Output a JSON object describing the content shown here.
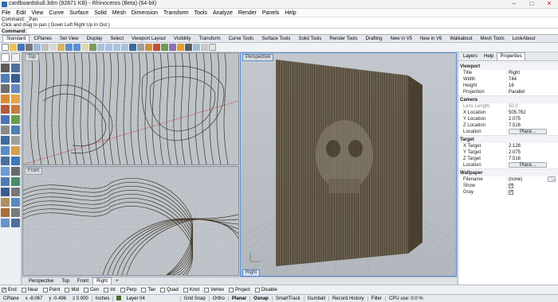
{
  "window": {
    "title": "cardboardskull.3dm (92871 KB) - Rhinoceros (Beta) (64-bit)",
    "min": "–",
    "max": "□",
    "close": "✕"
  },
  "menu": [
    "File",
    "Edit",
    "View",
    "Curve",
    "Surface",
    "Solid",
    "Mesh",
    "Dimension",
    "Transform",
    "Tools",
    "Analyze",
    "Render",
    "Panels",
    "Help"
  ],
  "command": {
    "history": [
      "Command: _Pan",
      "Click and drag to pan ( Down  Left  Right  Up  In  Out )"
    ],
    "prompt_label": "Command:",
    "value": ""
  },
  "toolbar_tabs": [
    "Standard",
    "CPlanes",
    "Set View",
    "Display",
    "Select",
    "Viewport Layout",
    "Visibility",
    "Transform",
    "Curve Tools",
    "Surface Tools",
    "Solid Tools",
    "Render Tools",
    "Drafting",
    "New in V5",
    "New in V6",
    "Walkabout",
    "Mesh Tools",
    "LookAbout"
  ],
  "toolbar_tabs_active": 0,
  "viewports": {
    "top": "Top",
    "front": "Front",
    "perspective": "Perspective",
    "right": "Right"
  },
  "viewport_tabs": [
    "Perspective",
    "Top",
    "Front",
    "Right",
    "+"
  ],
  "viewport_tabs_active": 3,
  "panel_tabs": [
    "Layers",
    "Help",
    "Properties"
  ],
  "panel_tabs_active": 2,
  "properties": {
    "viewport_title": "Viewport",
    "title_k": "Title",
    "title_v": "Right",
    "width_k": "Width",
    "width_v": "744",
    "height_k": "Height",
    "height_v": "16",
    "projection_k": "Projection",
    "projection_v": "Parallel",
    "camera_title": "Camera",
    "lens_k": "Lens Length",
    "lens_v": "50.0",
    "x_k": "X Location",
    "x_v": "505.762",
    "y_k": "Y Location",
    "y_v": "2.075",
    "z_k": "Z Location",
    "z_v": "7.516",
    "loc_k": "Location",
    "place_btn": "Place...",
    "target_title": "Target",
    "tx_k": "X Target",
    "tx_v": "2.126",
    "ty_k": "Y Target",
    "ty_v": "2.075",
    "tz_k": "Z Target",
    "tz_v": "7.516",
    "tloc_k": "Location",
    "tplace_btn": "Place...",
    "wallpaper_title": "Wallpaper",
    "filename_k": "Filename",
    "filename_v": "(none)",
    "filename_btn": "...",
    "show_k": "Show",
    "gray_k": "Gray"
  },
  "osnap": [
    {
      "label": "End",
      "checked": true
    },
    {
      "label": "Near",
      "checked": false
    },
    {
      "label": "Point",
      "checked": false
    },
    {
      "label": "Mid",
      "checked": false
    },
    {
      "label": "Cen",
      "checked": false
    },
    {
      "label": "Int",
      "checked": false
    },
    {
      "label": "Perp",
      "checked": false
    },
    {
      "label": "Tan",
      "checked": false
    },
    {
      "label": "Quad",
      "checked": false
    },
    {
      "label": "Knot",
      "checked": false
    },
    {
      "label": "Vertex",
      "checked": false
    },
    {
      "label": "Project",
      "checked": false
    },
    {
      "label": "Disable",
      "checked": false
    }
  ],
  "status": {
    "cplane": "CPlane",
    "x": "x -8.067",
    "y": "y -0.496",
    "z": "z 0.000",
    "units": "Inches",
    "layer": "Layer 04",
    "gridsnap": "Grid Snap",
    "ortho": "Ortho",
    "planar": "Planar",
    "osnap": "Osnap",
    "smarttrack": "SmartTrack",
    "gumball": "Gumball",
    "record": "Record History",
    "filter": "Filter",
    "cpu": "CPU use: 0.0 %"
  },
  "colors": {
    "accent": "#5b8fd1",
    "curve": "#3e3526",
    "layer": "#4a6b2a"
  }
}
